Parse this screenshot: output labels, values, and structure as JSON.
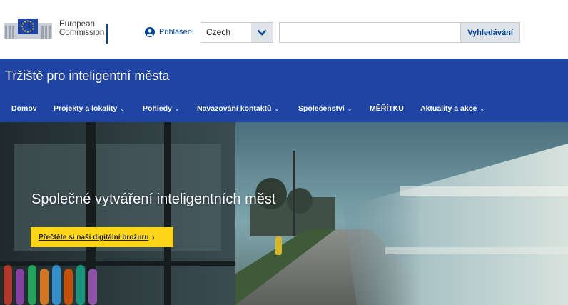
{
  "header": {
    "logo_line1": "European",
    "logo_line2": "Commission",
    "login_label": "Přihlášení",
    "language": {
      "selected": "Czech"
    },
    "search": {
      "placeholder": "",
      "button_label": "Vyhledávání"
    }
  },
  "site": {
    "title": "Tržiště pro inteligentní města"
  },
  "nav": {
    "items": [
      {
        "label": "Domov",
        "has_dropdown": false
      },
      {
        "label": "Projekty a lokality",
        "has_dropdown": true
      },
      {
        "label": "Pohledy",
        "has_dropdown": true
      },
      {
        "label": "Navazování kontaktů",
        "has_dropdown": true
      },
      {
        "label": "Společenství",
        "has_dropdown": true
      },
      {
        "label": "MĚŘÍTKU",
        "has_dropdown": false
      },
      {
        "label": "Aktuality a akce",
        "has_dropdown": true
      }
    ],
    "dropdown_glyph": "⌄"
  },
  "hero": {
    "title": "Společné vytváření inteligentních měst",
    "cta_label": "Přečtěte si naši digitální brožuru",
    "cta_glyph": "›"
  },
  "colors": {
    "brand_blue": "#1e45a3",
    "link_blue": "#004494",
    "cta_yellow": "#ffd617"
  },
  "icons": {
    "login": "user-circle-icon",
    "language": "chevron-down-icon",
    "logo": "eu-flag-icon"
  }
}
